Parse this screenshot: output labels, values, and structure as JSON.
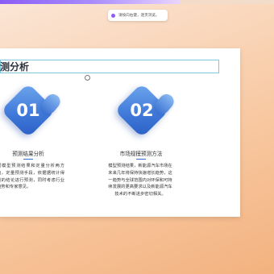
{
  "progress": {
    "fraction": 0.66
  },
  "toast": {
    "text": "请按向右键，逐页浏览。"
  },
  "slide": {
    "title": "测分析",
    "cards": [
      {
        "number": "01",
        "heading": "预测结果分析",
        "body": "据模型预测结果和定量分析两方面，定量预测手段，依据据统计得到的结论进行预测，同时考虑行业趋势和专家意见。"
      },
      {
        "number": "02",
        "heading": "市场规模预测方法",
        "body": "模型预测结果，新能源汽车市场在未来几年将保持快速增长趋势，这一趋势与全球范围内对环保和可持续发展的更高要求以及新能源汽车技术的不断进步密切相关。"
      }
    ]
  },
  "colors": {
    "accent": "#8b5cf6",
    "diamond": "#3e77d8",
    "underline": "#2f6fd6"
  }
}
